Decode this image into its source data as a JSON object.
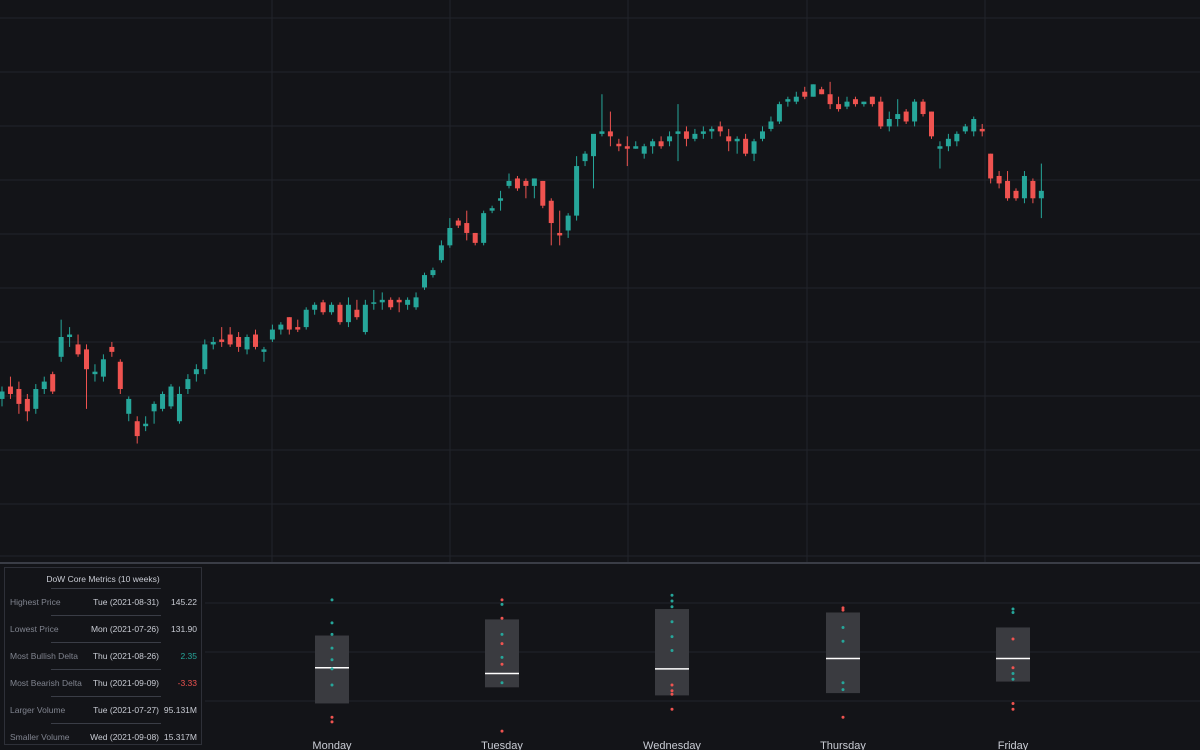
{
  "colors": {
    "background": "#131418",
    "grid": "#22242b",
    "up": "#26a69a",
    "down": "#ef5350",
    "box_fill": "#3a3b40",
    "median": "#ffffff",
    "divider": "#3a3d46"
  },
  "chart_data": [
    {
      "type": "candlestick",
      "title": "",
      "grid": true,
      "axes_labels_visible": false,
      "candles": [
        {
          "o": 132.8,
          "h": 133.3,
          "l": 132.5,
          "c": 133.1
        },
        {
          "o": 133.3,
          "h": 133.7,
          "l": 132.8,
          "c": 133.0
        },
        {
          "o": 133.2,
          "h": 133.5,
          "l": 132.2,
          "c": 132.6
        },
        {
          "o": 132.8,
          "h": 133.0,
          "l": 131.9,
          "c": 132.3
        },
        {
          "o": 132.4,
          "h": 133.4,
          "l": 132.2,
          "c": 133.2
        },
        {
          "o": 133.2,
          "h": 133.7,
          "l": 133.0,
          "c": 133.5
        },
        {
          "o": 133.8,
          "h": 133.9,
          "l": 133.0,
          "c": 133.1
        },
        {
          "o": 134.5,
          "h": 136.0,
          "l": 134.3,
          "c": 135.3
        },
        {
          "o": 135.3,
          "h": 135.7,
          "l": 134.9,
          "c": 135.4
        },
        {
          "o": 135.0,
          "h": 135.4,
          "l": 134.5,
          "c": 134.6
        },
        {
          "o": 134.8,
          "h": 135.0,
          "l": 132.4,
          "c": 134.0
        },
        {
          "o": 133.8,
          "h": 134.2,
          "l": 133.5,
          "c": 133.9
        },
        {
          "o": 133.7,
          "h": 134.6,
          "l": 133.5,
          "c": 134.4
        },
        {
          "o": 134.9,
          "h": 135.1,
          "l": 134.5,
          "c": 134.7
        },
        {
          "o": 134.3,
          "h": 134.4,
          "l": 133.0,
          "c": 133.2
        },
        {
          "o": 132.2,
          "h": 132.9,
          "l": 131.9,
          "c": 132.8
        },
        {
          "o": 131.9,
          "h": 132.1,
          "l": 131.0,
          "c": 131.3
        },
        {
          "o": 131.7,
          "h": 132.1,
          "l": 131.5,
          "c": 131.8
        },
        {
          "o": 132.3,
          "h": 132.7,
          "l": 131.8,
          "c": 132.6
        },
        {
          "o": 132.4,
          "h": 133.1,
          "l": 132.3,
          "c": 133.0
        },
        {
          "o": 132.5,
          "h": 133.4,
          "l": 132.4,
          "c": 133.3
        },
        {
          "o": 131.9,
          "h": 133.3,
          "l": 131.8,
          "c": 133.0
        },
        {
          "o": 133.2,
          "h": 133.8,
          "l": 133.0,
          "c": 133.6
        },
        {
          "o": 133.8,
          "h": 134.2,
          "l": 133.5,
          "c": 134.0
        },
        {
          "o": 134.0,
          "h": 135.2,
          "l": 133.8,
          "c": 135.0
        },
        {
          "o": 135.0,
          "h": 135.3,
          "l": 134.8,
          "c": 135.1
        },
        {
          "o": 135.2,
          "h": 135.7,
          "l": 134.9,
          "c": 135.1
        },
        {
          "o": 135.4,
          "h": 135.7,
          "l": 134.9,
          "c": 135.0
        },
        {
          "o": 135.3,
          "h": 135.5,
          "l": 134.7,
          "c": 134.9
        },
        {
          "o": 134.8,
          "h": 135.4,
          "l": 134.6,
          "c": 135.3
        },
        {
          "o": 135.4,
          "h": 135.6,
          "l": 134.8,
          "c": 134.9
        },
        {
          "o": 134.7,
          "h": 134.9,
          "l": 134.3,
          "c": 134.8
        },
        {
          "o": 135.2,
          "h": 135.8,
          "l": 135.1,
          "c": 135.6
        },
        {
          "o": 135.6,
          "h": 135.9,
          "l": 135.4,
          "c": 135.8
        },
        {
          "o": 136.1,
          "h": 136.1,
          "l": 135.4,
          "c": 135.6
        },
        {
          "o": 135.7,
          "h": 136.0,
          "l": 135.5,
          "c": 135.6
        },
        {
          "o": 135.7,
          "h": 136.5,
          "l": 135.6,
          "c": 136.4
        },
        {
          "o": 136.4,
          "h": 136.7,
          "l": 136.2,
          "c": 136.6
        },
        {
          "o": 136.7,
          "h": 136.8,
          "l": 136.2,
          "c": 136.3
        },
        {
          "o": 136.3,
          "h": 136.7,
          "l": 136.2,
          "c": 136.6
        },
        {
          "o": 136.6,
          "h": 136.7,
          "l": 135.8,
          "c": 135.9
        },
        {
          "o": 135.9,
          "h": 136.9,
          "l": 135.7,
          "c": 136.6
        },
        {
          "o": 136.4,
          "h": 136.8,
          "l": 136.0,
          "c": 136.1
        },
        {
          "o": 135.5,
          "h": 136.8,
          "l": 135.4,
          "c": 136.6
        },
        {
          "o": 136.7,
          "h": 137.2,
          "l": 136.4,
          "c": 136.7
        },
        {
          "o": 136.7,
          "h": 137.1,
          "l": 136.4,
          "c": 136.8
        },
        {
          "o": 136.8,
          "h": 136.9,
          "l": 136.4,
          "c": 136.5
        },
        {
          "o": 136.8,
          "h": 136.9,
          "l": 136.3,
          "c": 136.7
        },
        {
          "o": 136.6,
          "h": 136.9,
          "l": 136.4,
          "c": 136.8
        },
        {
          "o": 136.5,
          "h": 137.1,
          "l": 136.4,
          "c": 136.9
        },
        {
          "o": 137.3,
          "h": 137.9,
          "l": 137.2,
          "c": 137.8
        },
        {
          "o": 137.8,
          "h": 138.1,
          "l": 137.7,
          "c": 138.0
        },
        {
          "o": 138.4,
          "h": 139.2,
          "l": 138.3,
          "c": 139.0
        },
        {
          "o": 139.0,
          "h": 140.1,
          "l": 138.9,
          "c": 139.7
        },
        {
          "o": 140.0,
          "h": 140.1,
          "l": 139.7,
          "c": 139.8
        },
        {
          "o": 139.9,
          "h": 140.4,
          "l": 139.2,
          "c": 139.5
        },
        {
          "o": 139.5,
          "h": 139.5,
          "l": 139.0,
          "c": 139.1
        },
        {
          "o": 139.1,
          "h": 140.4,
          "l": 139.0,
          "c": 140.3
        },
        {
          "o": 140.4,
          "h": 140.6,
          "l": 140.3,
          "c": 140.5
        },
        {
          "o": 140.8,
          "h": 141.2,
          "l": 140.4,
          "c": 140.9
        },
        {
          "o": 141.4,
          "h": 141.9,
          "l": 141.3,
          "c": 141.6
        },
        {
          "o": 141.7,
          "h": 141.8,
          "l": 141.2,
          "c": 141.3
        },
        {
          "o": 141.6,
          "h": 141.7,
          "l": 140.9,
          "c": 141.4
        },
        {
          "o": 141.4,
          "h": 141.7,
          "l": 140.9,
          "c": 141.7
        },
        {
          "o": 141.6,
          "h": 141.6,
          "l": 140.5,
          "c": 140.6
        },
        {
          "o": 140.8,
          "h": 140.9,
          "l": 139.0,
          "c": 139.9
        },
        {
          "o": 139.5,
          "h": 140.4,
          "l": 139.0,
          "c": 139.4
        },
        {
          "o": 139.6,
          "h": 140.3,
          "l": 139.3,
          "c": 140.2
        },
        {
          "o": 140.2,
          "h": 142.6,
          "l": 140.0,
          "c": 142.2
        },
        {
          "o": 142.4,
          "h": 142.8,
          "l": 142.2,
          "c": 142.7
        },
        {
          "o": 142.6,
          "h": 143.4,
          "l": 141.3,
          "c": 143.5
        },
        {
          "o": 143.5,
          "h": 145.1,
          "l": 143.4,
          "c": 143.6
        },
        {
          "o": 143.6,
          "h": 144.4,
          "l": 143.0,
          "c": 143.4
        },
        {
          "o": 143.1,
          "h": 143.3,
          "l": 142.8,
          "c": 143.0
        },
        {
          "o": 143.0,
          "h": 143.4,
          "l": 142.2,
          "c": 142.9
        },
        {
          "o": 142.9,
          "h": 143.2,
          "l": 142.9,
          "c": 143.0
        },
        {
          "o": 142.7,
          "h": 143.1,
          "l": 142.5,
          "c": 143.0
        },
        {
          "o": 143.0,
          "h": 143.3,
          "l": 142.7,
          "c": 143.2
        },
        {
          "o": 143.2,
          "h": 143.4,
          "l": 142.9,
          "c": 143.0
        },
        {
          "o": 143.2,
          "h": 143.6,
          "l": 143.0,
          "c": 143.4
        },
        {
          "o": 143.5,
          "h": 144.7,
          "l": 142.4,
          "c": 143.6
        },
        {
          "o": 143.6,
          "h": 143.8,
          "l": 143.0,
          "c": 143.3
        },
        {
          "o": 143.3,
          "h": 143.7,
          "l": 143.2,
          "c": 143.5
        },
        {
          "o": 143.5,
          "h": 143.8,
          "l": 143.3,
          "c": 143.6
        },
        {
          "o": 143.6,
          "h": 143.8,
          "l": 143.3,
          "c": 143.7
        },
        {
          "o": 143.8,
          "h": 144.0,
          "l": 143.4,
          "c": 143.6
        },
        {
          "o": 143.4,
          "h": 143.7,
          "l": 142.8,
          "c": 143.2
        },
        {
          "o": 143.2,
          "h": 143.4,
          "l": 142.7,
          "c": 143.3
        },
        {
          "o": 143.3,
          "h": 143.5,
          "l": 142.6,
          "c": 142.7
        },
        {
          "o": 142.7,
          "h": 143.3,
          "l": 142.4,
          "c": 143.2
        },
        {
          "o": 143.3,
          "h": 143.8,
          "l": 143.2,
          "c": 143.6
        },
        {
          "o": 143.7,
          "h": 144.2,
          "l": 143.6,
          "c": 144.0
        },
        {
          "o": 144.0,
          "h": 144.8,
          "l": 143.9,
          "c": 144.7
        },
        {
          "o": 144.8,
          "h": 145.0,
          "l": 144.6,
          "c": 144.9
        },
        {
          "o": 144.8,
          "h": 145.2,
          "l": 144.7,
          "c": 145.0
        },
        {
          "o": 145.2,
          "h": 145.4,
          "l": 144.9,
          "c": 145.0
        },
        {
          "o": 145.0,
          "h": 145.5,
          "l": 145.0,
          "c": 145.5
        },
        {
          "o": 145.3,
          "h": 145.4,
          "l": 145.1,
          "c": 145.1
        },
        {
          "o": 145.1,
          "h": 145.6,
          "l": 144.5,
          "c": 144.7
        },
        {
          "o": 144.7,
          "h": 145.0,
          "l": 144.4,
          "c": 144.5
        },
        {
          "o": 144.6,
          "h": 145.0,
          "l": 144.5,
          "c": 144.8
        },
        {
          "o": 144.9,
          "h": 145.0,
          "l": 144.6,
          "c": 144.7
        },
        {
          "o": 144.7,
          "h": 144.8,
          "l": 144.6,
          "c": 144.8
        },
        {
          "o": 145.0,
          "h": 145.0,
          "l": 144.6,
          "c": 144.7
        },
        {
          "o": 144.8,
          "h": 145.0,
          "l": 143.7,
          "c": 143.8
        },
        {
          "o": 143.8,
          "h": 144.4,
          "l": 143.6,
          "c": 144.1
        },
        {
          "o": 144.1,
          "h": 144.9,
          "l": 143.8,
          "c": 144.3
        },
        {
          "o": 144.4,
          "h": 144.5,
          "l": 143.9,
          "c": 144.0
        },
        {
          "o": 144.0,
          "h": 144.9,
          "l": 143.8,
          "c": 144.8
        },
        {
          "o": 144.8,
          "h": 144.9,
          "l": 144.2,
          "c": 144.3
        },
        {
          "o": 144.4,
          "h": 144.4,
          "l": 143.3,
          "c": 143.4
        },
        {
          "o": 142.9,
          "h": 143.2,
          "l": 142.1,
          "c": 143.0
        },
        {
          "o": 143.0,
          "h": 143.5,
          "l": 142.8,
          "c": 143.3
        },
        {
          "o": 143.2,
          "h": 143.6,
          "l": 143.0,
          "c": 143.5
        },
        {
          "o": 143.6,
          "h": 143.9,
          "l": 143.5,
          "c": 143.8
        },
        {
          "o": 143.6,
          "h": 144.2,
          "l": 143.4,
          "c": 144.1
        },
        {
          "o": 143.7,
          "h": 143.9,
          "l": 143.4,
          "c": 143.6
        },
        {
          "o": 142.7,
          "h": 142.7,
          "l": 141.5,
          "c": 141.7
        },
        {
          "o": 141.8,
          "h": 142.0,
          "l": 141.3,
          "c": 141.5
        },
        {
          "o": 141.6,
          "h": 142.0,
          "l": 140.8,
          "c": 140.9
        },
        {
          "o": 141.2,
          "h": 141.3,
          "l": 140.8,
          "c": 140.9
        },
        {
          "o": 140.9,
          "h": 142.0,
          "l": 140.7,
          "c": 141.8
        },
        {
          "o": 141.6,
          "h": 141.7,
          "l": 140.7,
          "c": 140.9
        },
        {
          "o": 140.9,
          "h": 142.3,
          "l": 140.1,
          "c": 141.2
        }
      ]
    },
    {
      "type": "boxplot",
      "title": "",
      "categories": [
        "Monday",
        "Tuesday",
        "Wednesday",
        "Thursday",
        "Friday"
      ],
      "ylim": [
        -3.6,
        3.0
      ],
      "boxes": [
        {
          "q1": -2.1,
          "median": -0.55,
          "q3": 0.85,
          "points_up": [
            2.4,
            1.4,
            0.9,
            0.3,
            -0.2,
            -0.6,
            -1.3
          ],
          "points_down": [
            -2.7,
            -2.9
          ]
        },
        {
          "q1": -1.4,
          "median": -0.8,
          "q3": 1.55,
          "points_up": [
            2.2,
            0.9,
            -0.1,
            -1.2
          ],
          "points_down": [
            2.4,
            1.6,
            0.5,
            -0.4,
            -3.3
          ]
        },
        {
          "q1": -1.75,
          "median": -0.6,
          "q3": 2.0,
          "points_up": [
            2.6,
            2.35,
            2.1,
            1.45,
            0.8,
            0.2
          ],
          "points_down": [
            -1.3,
            -1.55,
            -1.7,
            -2.35
          ]
        },
        {
          "q1": -1.65,
          "median": -0.15,
          "q3": 1.85,
          "points_up": [
            1.2,
            0.6,
            -1.2,
            -1.5
          ],
          "points_down": [
            2.05,
            1.95,
            -2.7
          ]
        },
        {
          "q1": -1.15,
          "median": -0.15,
          "q3": 1.2,
          "points_up": [
            2.0,
            1.85,
            -0.8,
            -1.05
          ],
          "points_down": [
            0.7,
            -0.55,
            -2.1,
            -2.35
          ]
        }
      ]
    }
  ],
  "metrics": {
    "title": "DoW Core Metrics (10 weeks)",
    "rows": [
      {
        "label": "Highest Price",
        "date": "Tue (2021-08-31)",
        "value": "145.22",
        "tone": "neutral"
      },
      {
        "label": "Lowest Price",
        "date": "Mon (2021-07-26)",
        "value": "131.90",
        "tone": "neutral"
      },
      {
        "label": "Most Bullish Delta",
        "date": "Thu (2021-08-26)",
        "value": "2.35",
        "tone": "up"
      },
      {
        "label": "Most Bearish Delta",
        "date": "Thu (2021-09-09)",
        "value": "-3.33",
        "tone": "down"
      },
      {
        "label": "Larger Volume",
        "date": "Tue (2021-07-27)",
        "value": "95.131M",
        "tone": "neutral"
      },
      {
        "label": "Smaller Volume",
        "date": "Wed (2021-09-08)",
        "value": "15.317M",
        "tone": "neutral"
      }
    ]
  }
}
